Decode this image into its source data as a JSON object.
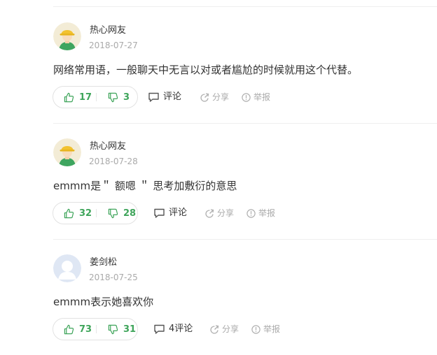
{
  "comments": [
    {
      "username": "热心网友",
      "date": "2018-07-27",
      "content": "网络常用语，一般聊天中无言以对或者尴尬的时候就用这个代替。",
      "upvotes": "17",
      "downvotes": "3",
      "comment_label": "评论",
      "share_label": "分享",
      "report_label": "举报",
      "avatar": "hardhat-worker-avatar"
    },
    {
      "username": "热心网友",
      "date": "2018-07-28",
      "content": "emmm是＂ 额嗯 ＂ 思考加敷衍的意思",
      "upvotes": "32",
      "downvotes": "28",
      "comment_label": "评论",
      "share_label": "分享",
      "report_label": "举报",
      "avatar": "hardhat-worker-avatar"
    },
    {
      "username": "姜剑松",
      "date": "2018-07-25",
      "content": "emmm表示她喜欢你",
      "upvotes": "73",
      "downvotes": "31",
      "comment_label": "4评论",
      "share_label": "分享",
      "report_label": "举报",
      "avatar": "default-user-avatar"
    }
  ],
  "colors": {
    "vote_green": "#3fa55b",
    "muted_gray": "#aaaaaa",
    "text": "#333333",
    "divider": "#eeeeee"
  }
}
